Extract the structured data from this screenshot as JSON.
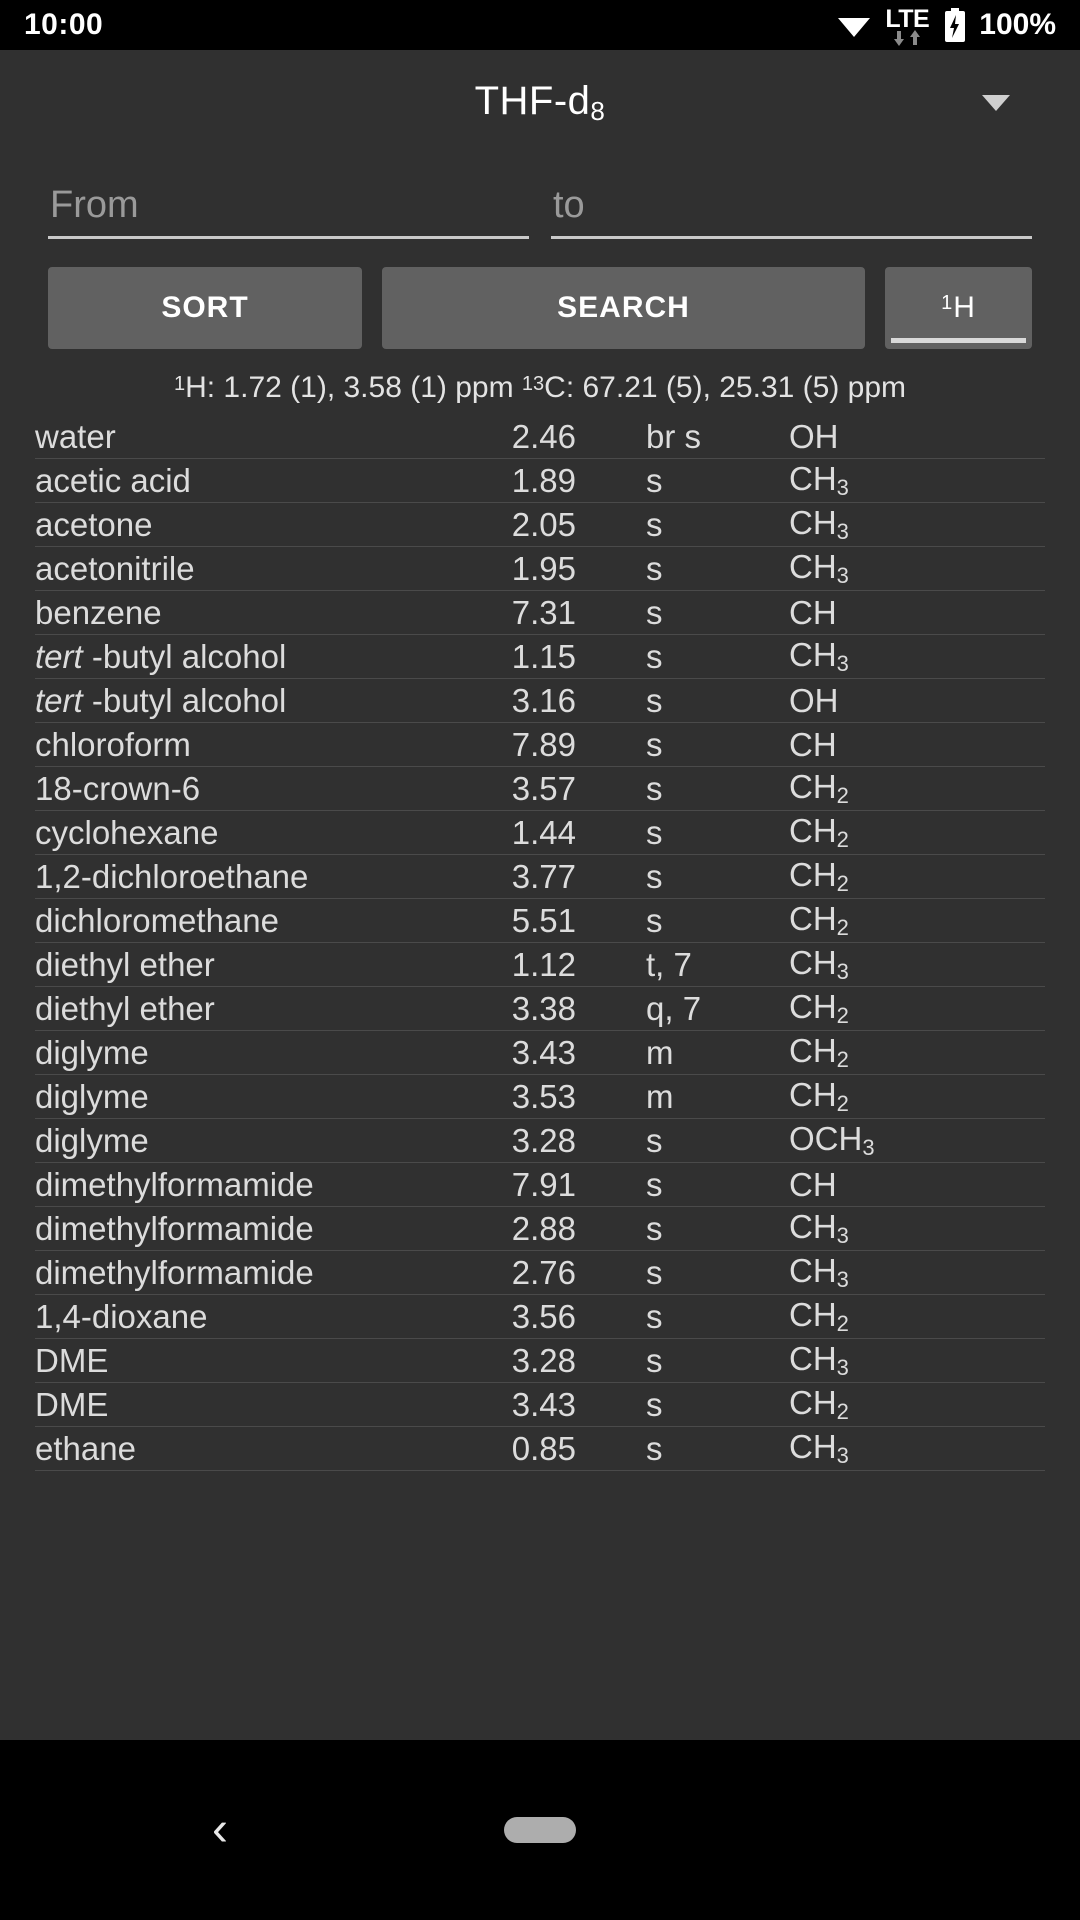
{
  "statusbar": {
    "time": "10:00",
    "wifi_icon": "wifi-icon",
    "network_label": "LTE",
    "data_arrows_icon": "data-transfer-arrows-icon",
    "battery_icon": "battery-charging-icon",
    "battery_percent": "100%"
  },
  "titlebar": {
    "solvent_name": "THF-d",
    "solvent_subscript": "8",
    "spinner_icon": "chevron-down-icon"
  },
  "range": {
    "from_value": "",
    "from_placeholder": "From",
    "to_value": "",
    "to_placeholder": "to"
  },
  "toolbar": {
    "sort_label": "SORT",
    "search_label": "SEARCH",
    "nucleus_superscript": "1",
    "nucleus_label": "H"
  },
  "reference": {
    "h_sup": "1",
    "h_text": "H: 1.72 (1), 3.58 (1) ppm ",
    "c_sup": "13",
    "c_text": "C: 67.21 (5), 25.31 (5) ppm"
  },
  "table": {
    "rows": [
      {
        "name": "water",
        "italic_prefix": "",
        "shift": "2.46",
        "mult": "br s",
        "group": "OH",
        "sub": ""
      },
      {
        "name": "acetic acid",
        "italic_prefix": "",
        "shift": "1.89",
        "mult": "s",
        "group": "CH",
        "sub": "3"
      },
      {
        "name": "acetone",
        "italic_prefix": "",
        "shift": "2.05",
        "mult": "s",
        "group": "CH",
        "sub": "3"
      },
      {
        "name": "acetonitrile",
        "italic_prefix": "",
        "shift": "1.95",
        "mult": "s",
        "group": "CH",
        "sub": "3"
      },
      {
        "name": "benzene",
        "italic_prefix": "",
        "shift": "7.31",
        "mult": "s",
        "group": "CH",
        "sub": ""
      },
      {
        "name": "-butyl alcohol",
        "italic_prefix": "tert ",
        "shift": "1.15",
        "mult": "s",
        "group": "CH",
        "sub": "3"
      },
      {
        "name": "-butyl alcohol",
        "italic_prefix": "tert ",
        "shift": "3.16",
        "mult": "s",
        "group": "OH",
        "sub": ""
      },
      {
        "name": "chloroform",
        "italic_prefix": "",
        "shift": "7.89",
        "mult": "s",
        "group": "CH",
        "sub": ""
      },
      {
        "name": "18-crown-6",
        "italic_prefix": "",
        "shift": "3.57",
        "mult": "s",
        "group": "CH",
        "sub": "2"
      },
      {
        "name": "cyclohexane",
        "italic_prefix": "",
        "shift": "1.44",
        "mult": "s",
        "group": "CH",
        "sub": "2"
      },
      {
        "name": "1,2-dichloroethane",
        "italic_prefix": "",
        "shift": "3.77",
        "mult": "s",
        "group": "CH",
        "sub": "2"
      },
      {
        "name": "dichloromethane",
        "italic_prefix": "",
        "shift": "5.51",
        "mult": "s",
        "group": "CH",
        "sub": "2"
      },
      {
        "name": "diethyl ether",
        "italic_prefix": "",
        "shift": "1.12",
        "mult": "t, 7",
        "group": "CH",
        "sub": "3"
      },
      {
        "name": "diethyl ether",
        "italic_prefix": "",
        "shift": "3.38",
        "mult": "q, 7",
        "group": "CH",
        "sub": "2"
      },
      {
        "name": "diglyme",
        "italic_prefix": "",
        "shift": "3.43",
        "mult": "m",
        "group": "CH",
        "sub": "2"
      },
      {
        "name": "diglyme",
        "italic_prefix": "",
        "shift": "3.53",
        "mult": "m",
        "group": "CH",
        "sub": "2"
      },
      {
        "name": "diglyme",
        "italic_prefix": "",
        "shift": "3.28",
        "mult": "s",
        "group": "OCH",
        "sub": "3"
      },
      {
        "name": "dimethylformamide",
        "italic_prefix": "",
        "shift": "7.91",
        "mult": "s",
        "group": "CH",
        "sub": ""
      },
      {
        "name": "dimethylformamide",
        "italic_prefix": "",
        "shift": "2.88",
        "mult": "s",
        "group": "CH",
        "sub": "3"
      },
      {
        "name": "dimethylformamide",
        "italic_prefix": "",
        "shift": "2.76",
        "mult": "s",
        "group": "CH",
        "sub": "3"
      },
      {
        "name": "1,4-dioxane",
        "italic_prefix": "",
        "shift": "3.56",
        "mult": "s",
        "group": "CH",
        "sub": "2"
      },
      {
        "name": "DME",
        "italic_prefix": "",
        "shift": "3.28",
        "mult": "s",
        "group": "CH",
        "sub": "3"
      },
      {
        "name": "DME",
        "italic_prefix": "",
        "shift": "3.43",
        "mult": "s",
        "group": "CH",
        "sub": "2"
      },
      {
        "name": "ethane",
        "italic_prefix": "",
        "shift": "0.85",
        "mult": "s",
        "group": "CH",
        "sub": "3"
      }
    ]
  },
  "navbar": {
    "back_glyph": "‹",
    "back_icon": "back-chevron-icon",
    "home_icon": "home-pill-icon"
  },
  "colors": {
    "app_background": "#303030",
    "button_background": "#616161",
    "text_primary": "#dcdcdc",
    "divider": "#4a4a4a",
    "accent_underline": "#d9d9d9"
  }
}
